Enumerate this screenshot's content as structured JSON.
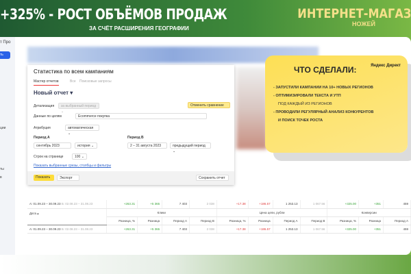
{
  "header": {
    "title": "+325% - РОСТ ОБЪЁМОВ ПРОДАЖ",
    "subtitle": "ЗА СЧЁТ РАСШИРЕНИЯ ГЕОГРАФИИ",
    "brand": "ИНТЕРНЕТ-МАГАЗ",
    "brand_sub": "НОЖЕЙ"
  },
  "sidebar": {
    "title": "т Про",
    "button": "ть",
    "items": [
      "ции",
      "ты",
      "в"
    ]
  },
  "card": {
    "title": "Статистика по всем кампаниям",
    "tabs": [
      "Мастер отчетов",
      "Все",
      "Поисковые запросы"
    ],
    "report": "Новый отчет ▾",
    "detail_label": "Детализация",
    "detail_value": "за выбранный период ⌄",
    "cancel_compare": "Отменить сравнение",
    "goals_label": "Данные по целям",
    "goals_value": "Ecommerce покупка",
    "attr_label": "Атрибуция",
    "attr_value": "автоматическая ⌄",
    "period_a": "Период А",
    "period_a_value": "сентябрь 2023",
    "period_a_mode": "история ⌄",
    "period_b": "Период B",
    "period_b_value": "2 – 31 августа 2023",
    "period_b_mode": "предыдущий период ⌄",
    "rows_label": "Строк на странице",
    "rows_value": "100 ⌄",
    "link": "Показать выбранные срезы, столбцы и фильтры",
    "show": "Показать",
    "export": "Экспорт",
    "save": "Сохранить отчет"
  },
  "promo": {
    "title": "ЧТО СДЕЛАЛИ:",
    "logo": "Яндекс Директ",
    "items": [
      "- ЗАПУСТИЛИ КАМПАНИИ НА 10+ НОВЫХ РЕГИОНОВ",
      "- ОПТИМИЗИРОВАЛИ ТЕКСТА И УТП",
      "ПОД КАЖДЫЙ ИЗ РЕГИОНОВ",
      "- ПРОВОДИЛИ РЕГУЛЯРНЫЙ АНАЛИЗ КОНКУРЕНТОВ",
      "И ПОИСК ТОЧЕК РОСТА"
    ]
  },
  "table": {
    "date_header": "Дата ▴",
    "groups": [
      "Клики",
      "Цена цели, рубли",
      "Конверсии"
    ],
    "subheaders": [
      "Разница, %",
      "Разница",
      "Период А",
      "Период B",
      "Разница, %",
      "Разница",
      "Период А",
      "Период B",
      "Разница, %",
      "Разница",
      "Период А"
    ],
    "period_a": "А: 01.09.23 – 30.09.23",
    "period_b": "Б: 02.08.23 – 31.08.23",
    "values": [
      "+263.31",
      "+5 365",
      "7 403",
      "2 038",
      "+17.38",
      "+186.57",
      "1 253.13",
      "1 067.56",
      "+325.00",
      "+351",
      "459"
    ]
  }
}
